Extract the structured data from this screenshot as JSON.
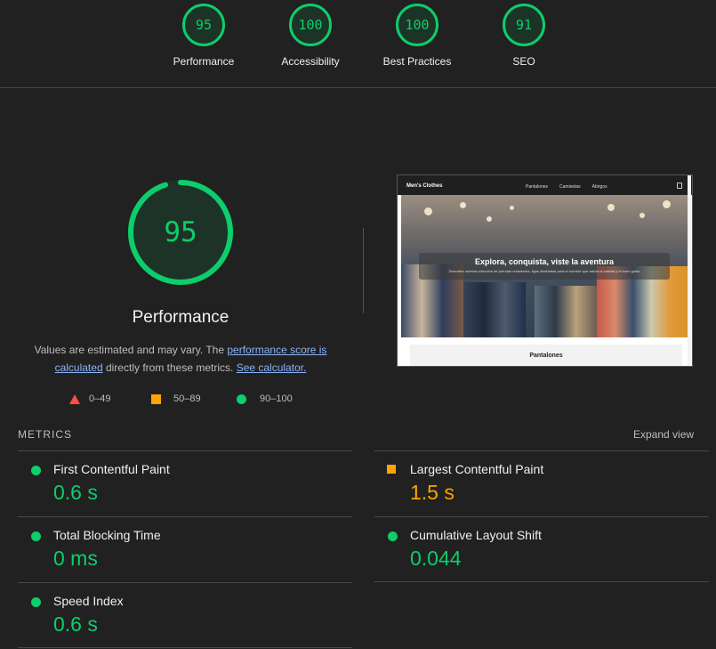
{
  "categories": [
    {
      "score": "95",
      "label": "Performance"
    },
    {
      "score": "100",
      "label": "Accessibility"
    },
    {
      "score": "100",
      "label": "Best Practices"
    },
    {
      "score": "91",
      "label": "SEO"
    }
  ],
  "performance": {
    "score": "95",
    "score_fraction": 0.95,
    "title": "Performance",
    "desc_part1": "Values are estimated and may vary. The",
    "desc_link1": "performance score is calculated",
    "desc_part2": "directly from these metrics.",
    "desc_link2": "See calculator."
  },
  "legend": {
    "fail": "0–49",
    "average": "50–89",
    "pass": "90–100"
  },
  "screenshot": {
    "brand": "Men's Clothes",
    "nav": [
      "Pantalones",
      "Camisetas",
      "Abrigos"
    ],
    "hero_title": "Explora, conquista, viste la aventura",
    "hero_subtitle": "Descubre nuestra colección de prendas resistentes, ligas diseñadas para el hombre que valora la calidad y el buen gusto",
    "card_title": "Pantalones"
  },
  "metrics": {
    "header": "METRICS",
    "expand": "Expand view",
    "items": [
      {
        "name": "First Contentful Paint",
        "value": "0.6 s",
        "status": "pass"
      },
      {
        "name": "Largest Contentful Paint",
        "value": "1.5 s",
        "status": "average"
      },
      {
        "name": "Total Blocking Time",
        "value": "0 ms",
        "status": "pass"
      },
      {
        "name": "Cumulative Layout Shift",
        "value": "0.044",
        "status": "pass"
      },
      {
        "name": "Speed Index",
        "value": "0.6 s",
        "status": "pass"
      }
    ]
  },
  "colors": {
    "pass": "#0cce6b",
    "average": "#ffa400",
    "fail": "#ff4e42"
  }
}
